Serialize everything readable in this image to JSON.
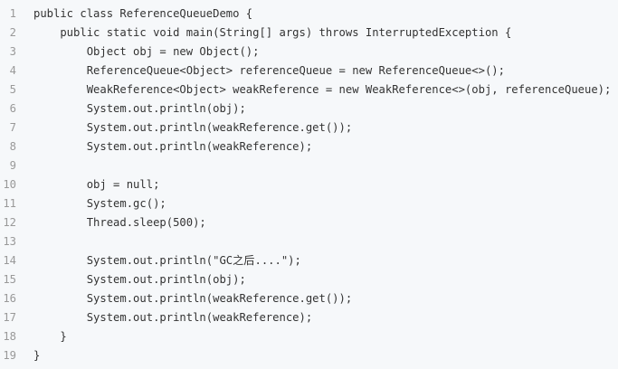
{
  "code": {
    "lines": [
      {
        "num": "1",
        "text": "public class ReferenceQueueDemo {"
      },
      {
        "num": "2",
        "text": "    public static void main(String[] args) throws InterruptedException {"
      },
      {
        "num": "3",
        "text": "        Object obj = new Object();"
      },
      {
        "num": "4",
        "text": "        ReferenceQueue<Object> referenceQueue = new ReferenceQueue<>();"
      },
      {
        "num": "5",
        "text": "        WeakReference<Object> weakReference = new WeakReference<>(obj, referenceQueue);"
      },
      {
        "num": "6",
        "text": "        System.out.println(obj);"
      },
      {
        "num": "7",
        "text": "        System.out.println(weakReference.get());"
      },
      {
        "num": "8",
        "text": "        System.out.println(weakReference);"
      },
      {
        "num": "9",
        "text": ""
      },
      {
        "num": "10",
        "text": "        obj = null;"
      },
      {
        "num": "11",
        "text": "        System.gc();"
      },
      {
        "num": "12",
        "text": "        Thread.sleep(500);"
      },
      {
        "num": "13",
        "text": ""
      },
      {
        "num": "14",
        "text": "        System.out.println(\"GC之后....\");"
      },
      {
        "num": "15",
        "text": "        System.out.println(obj);"
      },
      {
        "num": "16",
        "text": "        System.out.println(weakReference.get());"
      },
      {
        "num": "17",
        "text": "        System.out.println(weakReference);"
      },
      {
        "num": "18",
        "text": "    }"
      },
      {
        "num": "19",
        "text": "}"
      }
    ]
  }
}
